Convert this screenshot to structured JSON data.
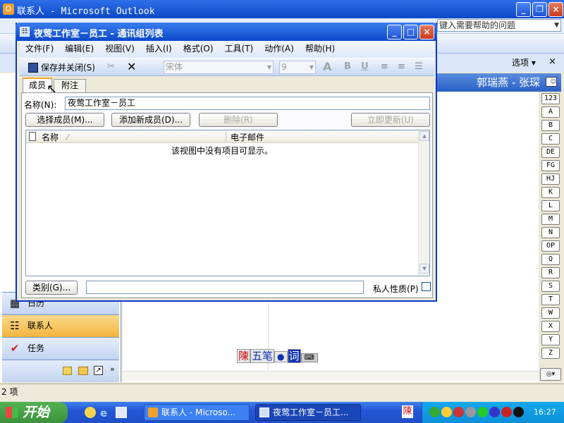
{
  "outlook": {
    "title": "联系人 - Microsoft Outlook",
    "help_placeholder": "键入需要帮助的问题",
    "options_label": "选项",
    "header_right": "郭瑞燕 - 张琛",
    "status_text": "2 项",
    "nav": {
      "calendar": "日历",
      "contacts": "联系人",
      "tasks": "任务"
    },
    "alpha_index": [
      "123",
      "A",
      "B",
      "C",
      "DE",
      "FG",
      "HJ",
      "K",
      "L",
      "M",
      "N",
      "OP",
      "Q",
      "R",
      "S",
      "T",
      "W",
      "X",
      "Y",
      "Z"
    ]
  },
  "dialog": {
    "title": "夜莺工作室－员工 - 通讯组列表",
    "menu": [
      "文件(F)",
      "编辑(E)",
      "视图(V)",
      "插入(I)",
      "格式(O)",
      "工具(T)",
      "动作(A)",
      "帮助(H)"
    ],
    "toolbar": {
      "save_close": "保存并关闭(S)",
      "font": "宋体",
      "size": "9",
      "bold": "B",
      "underline": "U",
      "font_color": "A"
    },
    "tabs": [
      "成员",
      "附注"
    ],
    "name_label": "名称(N):",
    "name_value": "夜莺工作室－员工",
    "buttons": {
      "select_members": "选择成员(M)...",
      "add_new": "添加新成员(D)...",
      "remove": "删除(R)",
      "update_now": "立即更新(U)"
    },
    "columns": [
      "名称",
      "电子邮件"
    ],
    "empty_text": "该视图中没有项目可显示。",
    "categories_btn": "类别(G)...",
    "private_label": "私人性质(P)",
    "private_checked": false
  },
  "ime": {
    "chars": [
      "陳",
      "五笔",
      "●",
      "词"
    ]
  },
  "taskbar": {
    "start": "开始",
    "tasks": [
      "联系人 - Microso...",
      "夜莺工作室－员工..."
    ],
    "time": "16:27"
  },
  "colors": {
    "xp_blue": "#0a54e3",
    "taskbar": "#245edb",
    "start": "#3c9a3c",
    "nav_selected": "#f8c86a"
  }
}
